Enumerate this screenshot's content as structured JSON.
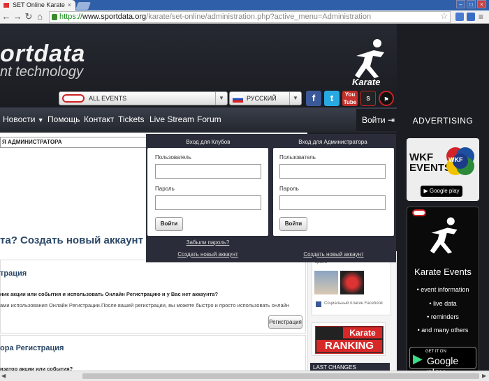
{
  "browser": {
    "tab_title": "SET Online Karate",
    "tab_close": "×",
    "url_https": "https://",
    "url_host": "www.sportdata.org",
    "url_path": "/karate/set-online/administration.php?active_menu=Administration"
  },
  "header": {
    "logo_main": "ortdata",
    "logo_sub": "nt technology",
    "karate": "Karate",
    "event_select": "ALL EVENTS",
    "lang_select": "РУССКИЙ"
  },
  "nav": {
    "items": [
      "Новости",
      "Помощь",
      "Контакт",
      "Tickets",
      "Live Stream",
      "Forum"
    ],
    "login": "Войти"
  },
  "sidebar": {
    "advertising": "ADVERTISING",
    "wkf": "WKF EVENTS",
    "wkf_badge": "WKF",
    "google_play_small": "Google play",
    "ke_title": "Karate Events",
    "ke_items": [
      "event information",
      "live data",
      "reminders",
      "and many others"
    ],
    "get_it_on": "GET IT ON",
    "google_play": "Google play"
  },
  "main": {
    "admin_box": "Я АДМИНИСТРАТОРА",
    "create_account": "та? Создать новый аккаунт",
    "section1_title": "трация",
    "section1_q": "ник акции или события и использовать Онлайн Регистрацию и у Вас нет аккаунта?",
    "section1_text": "ами использования Онлайн Регистрации.После вашей регистрации, вы можете быстро и просто использовать онлайн",
    "register_btn": "Регистрация",
    "section2_title": "ора Регистрация",
    "section2_q": "изатор акции или события?"
  },
  "right_panel": {
    "fb_label": "Социальный плагин Facebook",
    "ranking1": "Karate",
    "ranking2": "RANKING",
    "last_changes": "LAST CHANGES",
    "top_text": "брать"
  },
  "dropdown": {
    "clubs_title": "Вход для Клубов",
    "admin_title": "Вход для Администратора",
    "user_label": "Пользователь",
    "pass_label": "Пароль",
    "login_btn": "Войти",
    "forgot": "Забыли пароль?",
    "create": "Создать новый аккаунт"
  }
}
